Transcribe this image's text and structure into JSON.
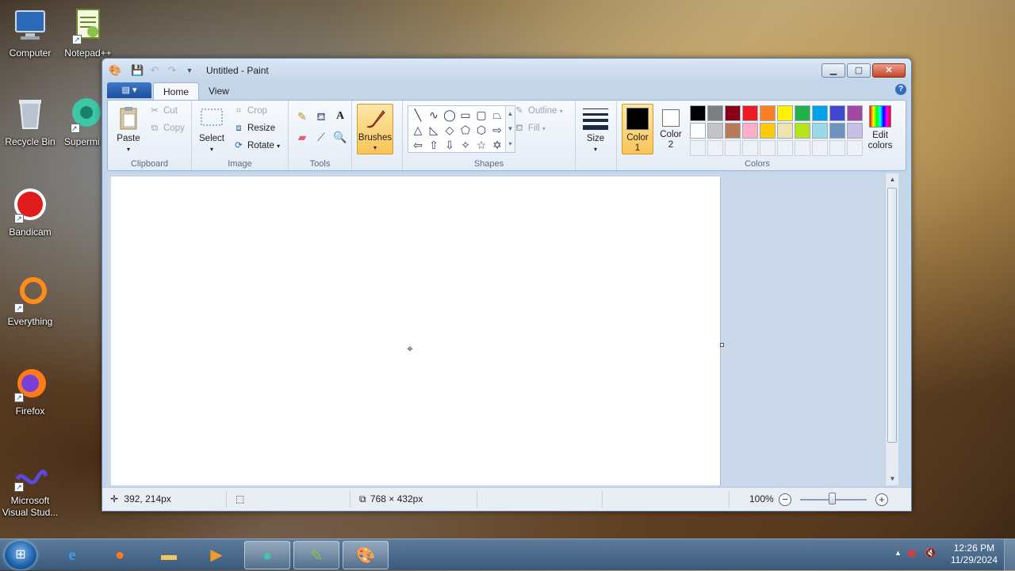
{
  "desktop": {
    "icons": [
      {
        "label": "Computer",
        "icon": "computer-icon"
      },
      {
        "label": "Notepad++",
        "icon": "notepadplusplus-icon"
      },
      {
        "label": "Recycle Bin",
        "icon": "recycle-bin-icon"
      },
      {
        "label": "Supermi",
        "icon": "supermium-icon"
      },
      {
        "label": "Bandicam",
        "icon": "bandicam-icon"
      },
      {
        "label": "Everything",
        "icon": "everything-icon"
      },
      {
        "label": "Firefox",
        "icon": "firefox-icon"
      },
      {
        "label": "Microsoft Visual Stud...",
        "icon": "visual-studio-icon"
      }
    ]
  },
  "window": {
    "title": "Untitled - Paint",
    "tabs": {
      "home": "Home",
      "view": "View"
    },
    "ribbon": {
      "clipboard": {
        "label": "Clipboard",
        "paste": "Paste",
        "cut": "Cut",
        "copy": "Copy"
      },
      "image": {
        "label": "Image",
        "select": "Select",
        "crop": "Crop",
        "resize": "Resize",
        "rotate": "Rotate"
      },
      "tools": {
        "label": "Tools"
      },
      "brushes": "Brushes",
      "shapes": {
        "label": "Shapes",
        "outline": "Outline",
        "fill": "Fill"
      },
      "size": "Size",
      "colors": {
        "label": "Colors",
        "color1": "Color\n1",
        "color2": "Color\n2",
        "edit": "Edit colors",
        "color1_value": "#000000",
        "color2_value": "#ffffff",
        "palette_row1": [
          "#000000",
          "#7f7f7f",
          "#880015",
          "#ed1c24",
          "#ff7f27",
          "#fff200",
          "#22b14c",
          "#00a2e8",
          "#3f48cc",
          "#a349a4"
        ],
        "palette_row2": [
          "#ffffff",
          "#c3c3c3",
          "#b97a57",
          "#ffaec9",
          "#ffc90e",
          "#efe4b0",
          "#b5e61d",
          "#99d9ea",
          "#7092be",
          "#c8bfe7"
        ]
      }
    },
    "status": {
      "cursor_pos": "392, 214px",
      "image_size": "768 × 432px",
      "zoom": "100%"
    }
  },
  "taskbar": {
    "time": "12:26 PM",
    "date": "11/29/2024"
  }
}
